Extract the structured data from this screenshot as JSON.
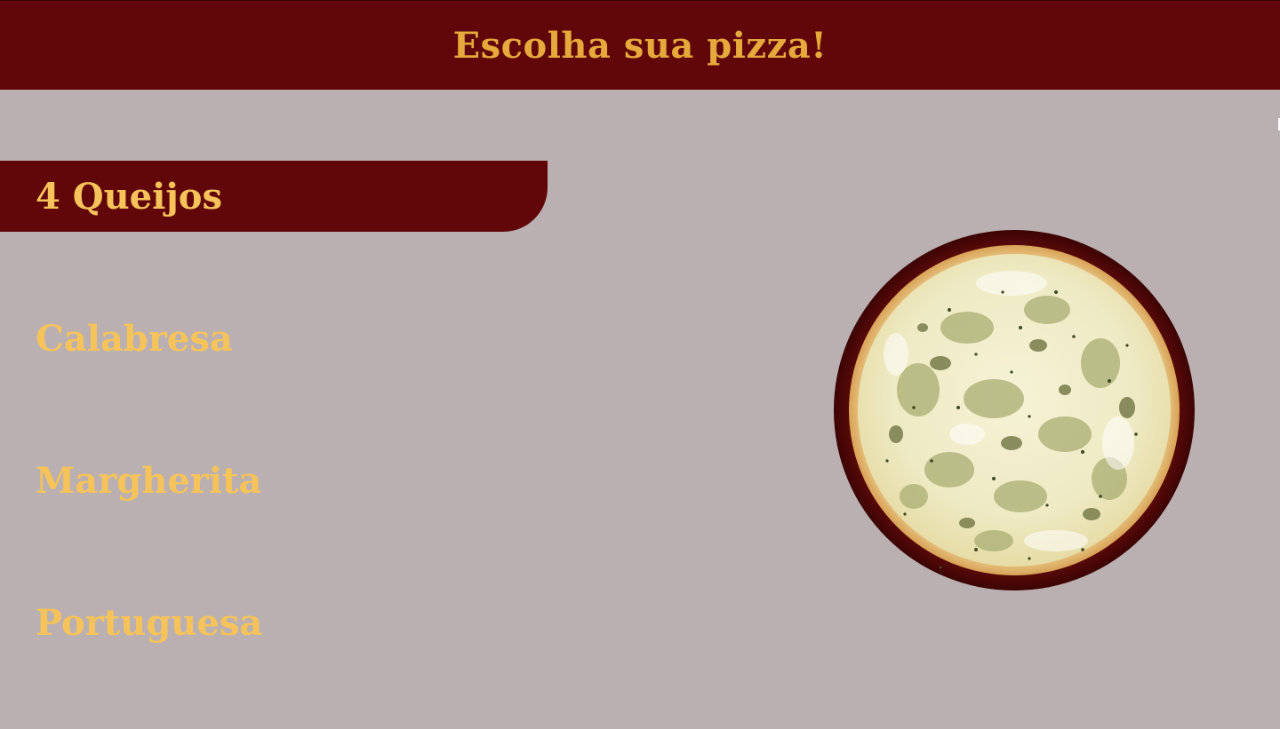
{
  "header": {
    "title": "Escolha sua pizza!"
  },
  "menu": {
    "items": [
      {
        "label": "4 Queijos",
        "active": true
      },
      {
        "label": "Calabresa",
        "active": false
      },
      {
        "label": "Margherita",
        "active": false
      },
      {
        "label": "Portuguesa",
        "active": false
      }
    ]
  },
  "colors": {
    "background": "#bab0b1",
    "header_bg": "#620709",
    "title_text": "#e6a93c",
    "menu_text": "#f6c35a",
    "active_item_bg": "#620709"
  },
  "image": {
    "subject": "pizza-4-queijos-image"
  }
}
